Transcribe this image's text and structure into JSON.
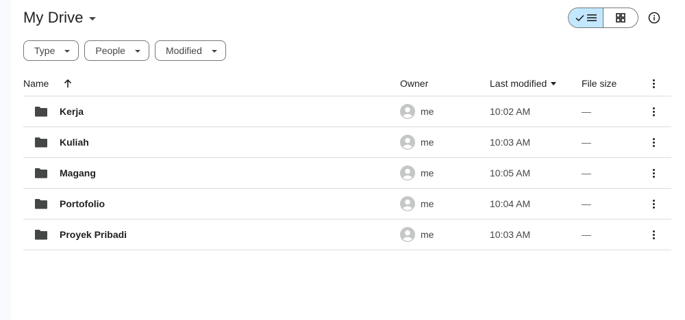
{
  "header": {
    "title": "My Drive"
  },
  "view_toggle": {
    "list_icon": "list-icon",
    "check_icon": "check-icon",
    "grid_icon": "grid-icon"
  },
  "info_icon": "info-icon",
  "filters": [
    {
      "label": "Type"
    },
    {
      "label": "People"
    },
    {
      "label": "Modified"
    }
  ],
  "table": {
    "columns": {
      "name": "Name",
      "owner": "Owner",
      "last_modified": "Last modified",
      "file_size": "File size"
    },
    "rows": [
      {
        "name": "Kerja",
        "owner": "me",
        "modified": "10:02 AM",
        "size": "—"
      },
      {
        "name": "Kuliah",
        "owner": "me",
        "modified": "10:03 AM",
        "size": "—"
      },
      {
        "name": "Magang",
        "owner": "me",
        "modified": "10:05 AM",
        "size": "—"
      },
      {
        "name": "Portofolio",
        "owner": "me",
        "modified": "10:04 AM",
        "size": "—"
      },
      {
        "name": "Proyek Pribadi",
        "owner": "me",
        "modified": "10:03 AM",
        "size": "—"
      }
    ]
  },
  "colors": {
    "accent": "#c2e7ff",
    "border": "#747775",
    "divider": "#dadce0",
    "text": "#1f1f1f",
    "background": "#f8fafd"
  }
}
